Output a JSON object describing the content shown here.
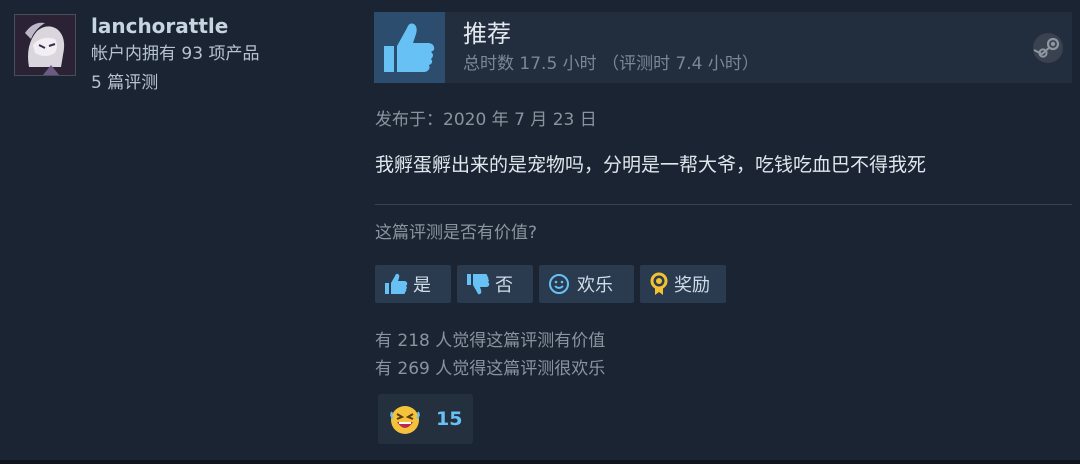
{
  "author": {
    "name": "lanchorattle",
    "products": "帐户内拥有 93 项产品",
    "reviews": "5 篇评测"
  },
  "review": {
    "verdict": "推荐",
    "hours": "总时数 17.5 小时  （评测时 7.4 小时）",
    "posted": "发布于：2020 年 7 月 23 日",
    "content": "我孵蛋孵出来的是宠物吗，分明是一帮大爷，吃钱吃血巴不得我死"
  },
  "helpful": {
    "question": "这篇评测是否有价值?",
    "yes_label": "是",
    "no_label": "否",
    "funny_label": "欢乐",
    "award_label": "奖励"
  },
  "stats": {
    "helpful_line": "有 218 人觉得这篇评测有价值",
    "funny_line": "有 269 人觉得这篇评测很欢乐"
  },
  "award": {
    "count": "15"
  },
  "colors": {
    "background": "#1b2433",
    "header": "#222d3d",
    "thumb_box": "#2c4d6e",
    "accent": "#67c1f5"
  },
  "icons": {
    "thumb": "thumbs-up-icon",
    "steam": "steam-logo-icon",
    "yes": "thumbs-up-icon",
    "no": "thumbs-down-icon",
    "funny": "smiley-icon",
    "award": "award-medal-icon",
    "award_emoji": "laughing-face-icon"
  }
}
